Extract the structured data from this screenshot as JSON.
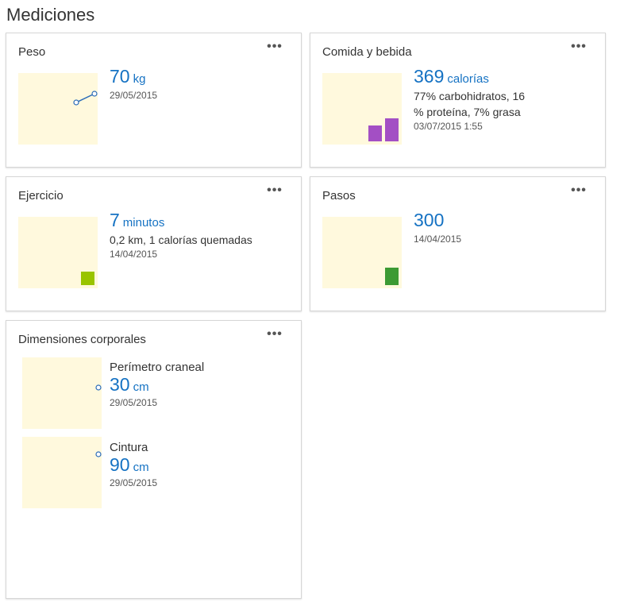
{
  "page": {
    "title": "Mediciones"
  },
  "more_label": "•••",
  "cards": {
    "peso": {
      "title": "Peso",
      "value": "70",
      "unit": "kg",
      "date": "29/05/2015"
    },
    "comida": {
      "title": "Comida y bebida",
      "value": "369",
      "unit": "calorías",
      "detail_line1": "77% carbohidratos, 16",
      "detail_line2": "% proteína, 7% grasa",
      "date": "03/07/2015 1:55",
      "bar_color": "#a34fc4"
    },
    "ejercicio": {
      "title": "Ejercicio",
      "value": "7",
      "unit": "minutos",
      "detail": "0,2 km, 1 calorías quemadas",
      "date": "14/04/2015",
      "bar_color": "#99c400"
    },
    "pasos": {
      "title": "Pasos",
      "value": "300",
      "date": "14/04/2015",
      "bar_color": "#3c9a33"
    },
    "dimensiones": {
      "title": "Dimensiones corporales",
      "items": [
        {
          "label": "Perímetro craneal",
          "value": "30",
          "unit": "cm",
          "date": "29/05/2015"
        },
        {
          "label": "Cintura",
          "value": "90",
          "unit": "cm",
          "date": "29/05/2015"
        }
      ]
    }
  },
  "colors": {
    "accent": "#1572c3",
    "thumb_bg": "#fff9dd",
    "line": "#2b6cb8"
  }
}
